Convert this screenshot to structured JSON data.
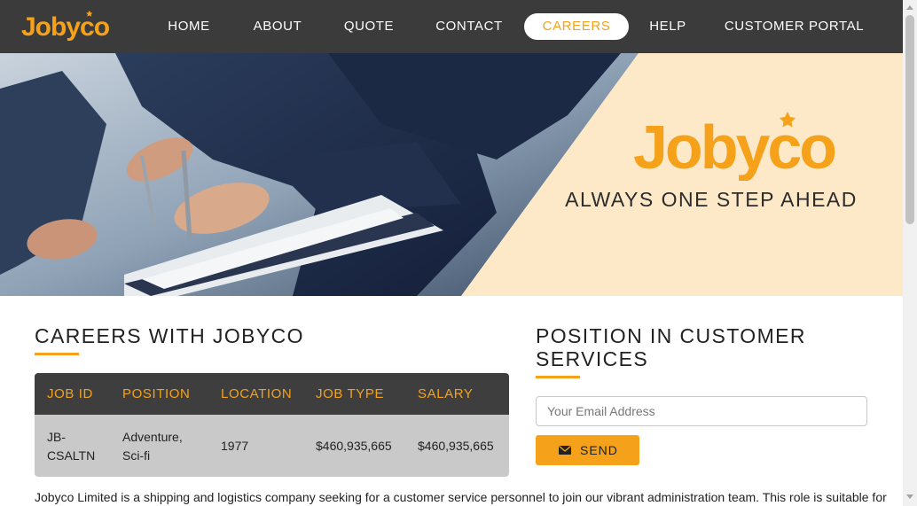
{
  "brand": {
    "name": "Jobyco",
    "accent": "#f5a21a",
    "nav_bg": "#3b3b3b",
    "hero_bg": "#fde9c8"
  },
  "nav": {
    "items": [
      {
        "label": "HOME"
      },
      {
        "label": "ABOUT"
      },
      {
        "label": "QUOTE"
      },
      {
        "label": "CONTACT"
      },
      {
        "label": "CAREERS",
        "active": true
      },
      {
        "label": "HELP"
      },
      {
        "label": "CUSTOMER PORTAL"
      }
    ]
  },
  "hero": {
    "logo_text": "Jobyco",
    "tagline": "ALWAYS ONE STEP AHEAD",
    "image": "business-people-signing-document"
  },
  "careers": {
    "title": "CAREERS WITH JOBYCO",
    "table": {
      "headers": [
        "JOB ID",
        "POSITION",
        "LOCATION",
        "JOB TYPE",
        "SALARY"
      ],
      "rows": [
        {
          "job_id": "JB-CSALTN",
          "position": "Adventure, Sci-fi",
          "location": "1977",
          "job_type": "$460,935,665",
          "salary": "$460,935,665"
        }
      ]
    },
    "description": "Jobyco Limited is a shipping and logistics company seeking for a customer service personnel to join our vibrant administration team. This role is suitable for"
  },
  "position": {
    "title_line1": "POSITION IN CUSTOMER",
    "title_line2": "SERVICES",
    "email_placeholder": "Your Email Address",
    "send_label": "SEND",
    "send_icon": "envelope-icon"
  }
}
